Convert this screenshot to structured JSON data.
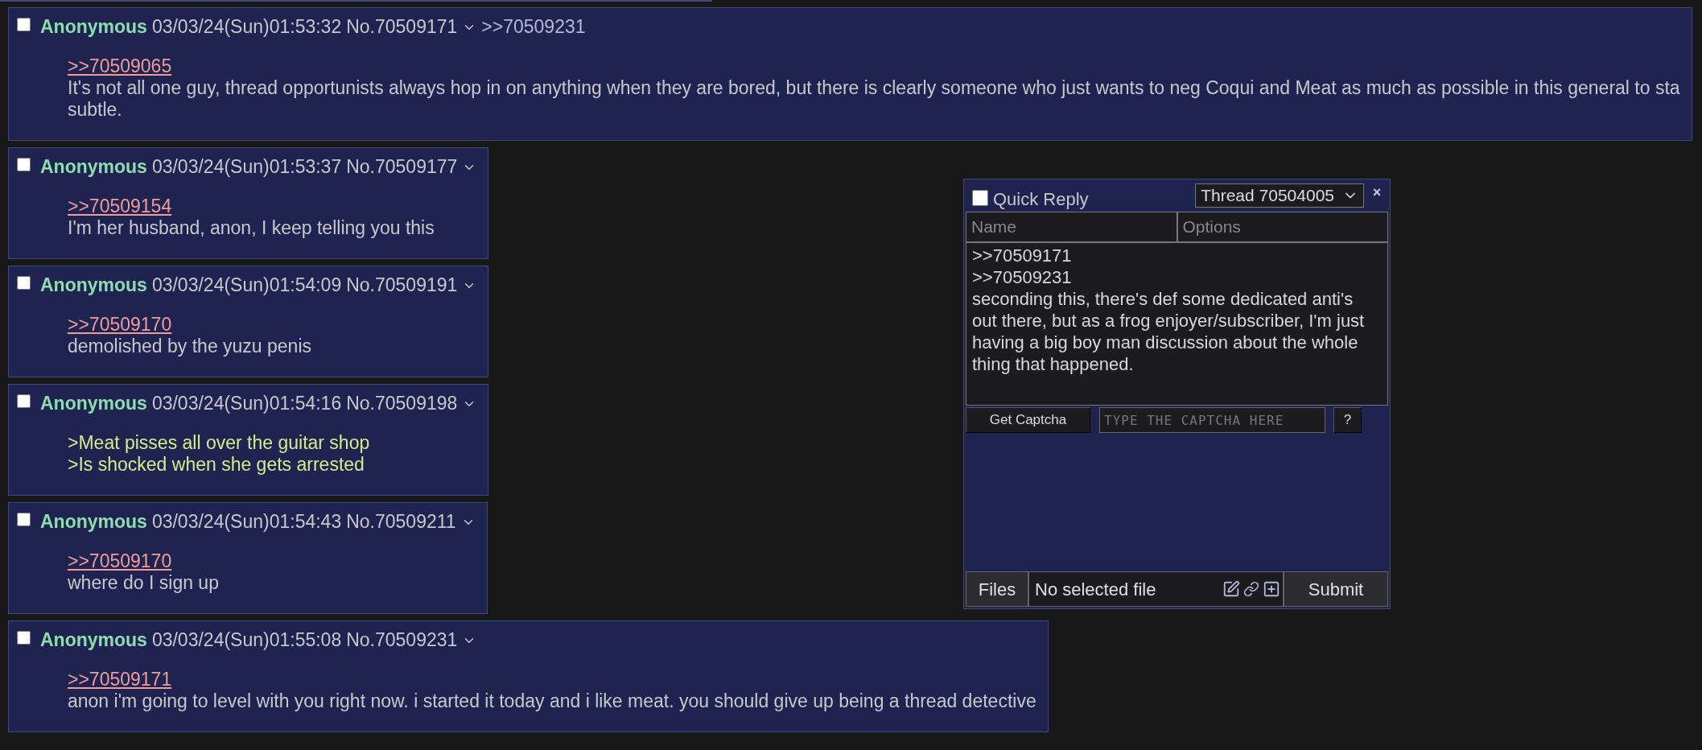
{
  "posts": [
    {
      "checked": false,
      "name": "Anonymous",
      "datetime": "03/03/24(Sun)01:53:32",
      "number": "No.70509171",
      "backlinks": [
        ">>70509231"
      ],
      "body": [
        {
          "kind": "quotelink",
          "text": ">>70509065"
        },
        {
          "kind": "text",
          "text": "It's not all one guy, thread opportunists always hop in on anything when they are bored, but there is clearly someone who just wants to neg Coqui and Meat as much as possible in this general to sta"
        },
        {
          "kind": "text",
          "text": "subtle."
        }
      ]
    },
    {
      "checked": false,
      "name": "Anonymous",
      "datetime": "03/03/24(Sun)01:53:37",
      "number": "No.70509177",
      "body": [
        {
          "kind": "quotelink",
          "text": ">>70509154"
        },
        {
          "kind": "text",
          "text": "I'm her husband, anon, I keep telling you this"
        }
      ]
    },
    {
      "checked": false,
      "name": "Anonymous",
      "datetime": "03/03/24(Sun)01:54:09",
      "number": "No.70509191",
      "body": [
        {
          "kind": "quotelink",
          "text": ">>70509170"
        },
        {
          "kind": "text",
          "text": "demolished by the yuzu penis"
        }
      ]
    },
    {
      "checked": false,
      "name": "Anonymous",
      "datetime": "03/03/24(Sun)01:54:16",
      "number": "No.70509198",
      "body": [
        {
          "kind": "greentext",
          "text": ">Meat pisses all over the guitar shop"
        },
        {
          "kind": "greentext",
          "text": ">Is shocked when she gets arrested"
        }
      ]
    },
    {
      "checked": false,
      "name": "Anonymous",
      "datetime": "03/03/24(Sun)01:54:43",
      "number": "No.70509211",
      "body": [
        {
          "kind": "quotelink",
          "text": ">>70509170"
        },
        {
          "kind": "text",
          "text": "where do I sign up"
        }
      ]
    },
    {
      "checked": false,
      "name": "Anonymous",
      "datetime": "03/03/24(Sun)01:55:08",
      "number": "No.70509231",
      "body": [
        {
          "kind": "quotelink",
          "text": ">>70509171"
        },
        {
          "kind": "text",
          "text": "anon i'm going to level with you right now. i started it today and i like meat. you should give up being a thread detective"
        }
      ]
    }
  ],
  "quick_reply": {
    "checked": false,
    "title": "Quick Reply",
    "thread": "Thread 70504005",
    "close": "×",
    "name_placeholder": "Name",
    "options_placeholder": "Options",
    "comment": ">>70509171\n>>70509231\nseconding this, there's def some dedicated anti's out there, but as a frog enjoyer/subscriber, I'm just having a big boy man discussion about the whole thing that happened. ",
    "captcha_button": "Get Captcha",
    "captcha_placeholder": "TYPE THE CAPTCHA HERE",
    "help": "?",
    "files_button": "Files",
    "file_status": "No selected file",
    "submit": "Submit"
  }
}
